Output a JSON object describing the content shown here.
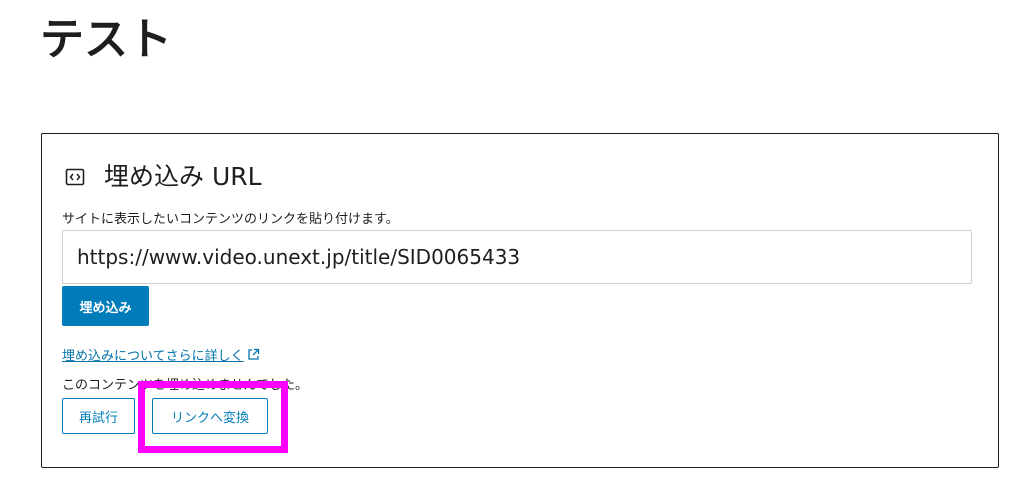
{
  "page": {
    "title": "テスト"
  },
  "embed": {
    "icon": "embed-code-icon",
    "label": "埋め込み URL",
    "instructions": "サイトに表示したいコンテンツのリンクを貼り付けます。",
    "url_value": "https://www.video.unext.jp/title/SID0065433",
    "embed_button_label": "埋め込み",
    "learn_more_label": "埋め込みについてさらに詳しく",
    "learn_more_icon": "external-link-icon",
    "error_message": "このコンテンツを埋め込めませんでした。",
    "retry_button_label": "再試行",
    "convert_button_label": "リンクへ変換"
  },
  "colors": {
    "primary": "#007cba",
    "link": "#0073aa",
    "highlight": "#ff00ff",
    "text": "#1e1e1e"
  }
}
